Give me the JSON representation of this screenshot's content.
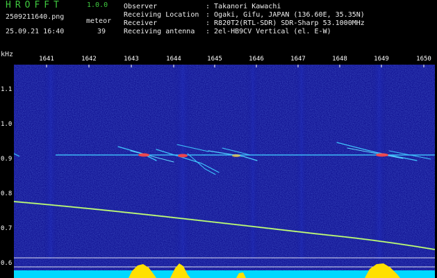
{
  "app": {
    "name": "HROFFT",
    "version": "1.0.0"
  },
  "file": {
    "name": "2509211640.png",
    "datetime": "25.09.21 16:40"
  },
  "meteor": {
    "label": "meteor",
    "count": "39"
  },
  "info_rows": [
    {
      "key": "Observer",
      "value": ": Takanori Kawachi"
    },
    {
      "key": "Receiving Location",
      "value": ": Ogaki, Gifu, JAPAN (136.60E, 35.35N)"
    },
    {
      "key": "Receiver",
      "value": ": R820T2(RTL-SDR) SDR-Sharp 53.1000MHz"
    },
    {
      "key": "Receiving antenna",
      "value": ": 2el-HB9CV Vertical (el. E-W)"
    }
  ],
  "axis": {
    "y_unit": "kHz",
    "x_ticks": [
      "1641",
      "1642",
      "1643",
      "1644",
      "1645",
      "1646",
      "1647",
      "1648",
      "1649",
      "1650"
    ],
    "y_ticks": [
      "1.1",
      "1.0",
      "0.9",
      "0.8",
      "0.7",
      "0.6"
    ]
  },
  "colors": {
    "title_green": "#3ec83e",
    "background_noise": "#0a0a8c",
    "signal_cyan": "#40c8ff",
    "trace_green": "#90e070",
    "meteor_red": "#ff4040",
    "spectrum_yellow": "#ffe000"
  }
}
